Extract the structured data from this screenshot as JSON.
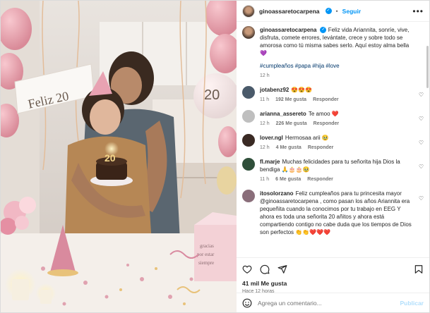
{
  "header": {
    "username": "ginoassaretocarpena",
    "follow_label": "Seguir",
    "more_label": "•••",
    "dot": "•"
  },
  "photo": {
    "banner_text": "Feliz 20",
    "balloon_number": "20",
    "box_text_1": "gracias",
    "box_text_2": "por estar",
    "box_text_3": "siempre"
  },
  "caption": {
    "username": "ginoassaretocarpena",
    "text": "Feliz vida Ariannita, sonríe, vive, disfruta, comete errores, levántate, crece y sobre todo se amorosa como tú misma sabes serlo. Aquí estoy alma bella 💜",
    "hashtags": "#cumpleaños #papa #hija #love",
    "time": "12 h"
  },
  "comments": [
    {
      "user": "jotabenz92",
      "text": "😍😍😍",
      "time": "11 h",
      "likes": "192 Me gusta",
      "reply": "Responder",
      "avatar_color": "#4a5a6a"
    },
    {
      "user": "arianna_assereto",
      "text": "Te amoo ❤️",
      "time": "12 h",
      "likes": "226 Me gusta",
      "reply": "Responder",
      "avatar_color": "#bfbfbf"
    },
    {
      "user": "lover.ngl",
      "text": "Hermosaa arii 🥹",
      "time": "12 h",
      "likes": "4 Me gusta",
      "reply": "Responder",
      "avatar_color": "#3a2a24"
    },
    {
      "user": "fl.marje",
      "text": "Muchas felicidades para tu señorita hija Dios la bendiga 🙏🎂🎂🥹",
      "time": "11 h",
      "likes": "6 Me gusta",
      "reply": "Responder",
      "avatar_color": "#2f4f3a"
    },
    {
      "user": "itosolorzano",
      "text": "Feliz cumpleaños para tu princesita mayor @ginoassaretocarpena , como pasan los años Ariannita era pequeñita cuando la conocimos por tu trabajo en EEG Y ahora es toda una señorita 20 añitos y ahora está compartiendo contigo no cabe duda que los tiempos de Dios son perfectos 👏👏❤️❤️❤️",
      "time": "",
      "likes": "",
      "reply": "",
      "avatar_color": "#8a6e7a"
    }
  ],
  "actions": {
    "likes": "41 mil Me gusta",
    "ago": "Hace 12 horas"
  },
  "compose": {
    "placeholder": "Agrega un comentario...",
    "publish": "Publicar"
  }
}
